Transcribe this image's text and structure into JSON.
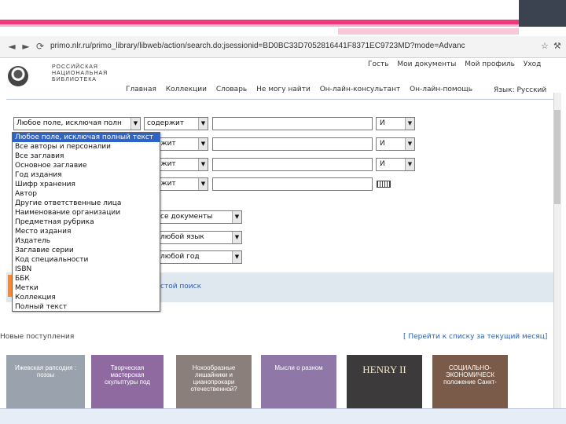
{
  "browser": {
    "url": "primo.nlr.ru/primo_library/libweb/action/search.do;jsessionid=BD0BC33D7052816441F8371EC9723MD?mode=Advanc"
  },
  "header": {
    "logo_text": "РОССИЙСКАЯ НАЦИОНАЛЬНАЯ БИБЛИОТЕКА",
    "top_links": [
      "Гость",
      "Мои документы",
      "Мой профиль",
      "Уход"
    ],
    "main_nav": [
      "Главная",
      "Коллекции",
      "Словарь",
      "Не могу найти",
      "Он-лайн-консультант",
      "Он-лайн-помощь"
    ],
    "language": "Язык: Русский"
  },
  "search": {
    "rows": [
      {
        "field": "Любое поле, исключая полн",
        "operator": "содержит",
        "bool": "И"
      },
      {
        "field": "",
        "operator": "держит",
        "bool": "И"
      },
      {
        "field": "",
        "operator": "держит",
        "bool": "И"
      },
      {
        "field": "",
        "operator": "держит",
        "bool": ""
      }
    ],
    "filters": [
      "се документы",
      "любой язык",
      "любой год"
    ],
    "advanced_link": "стой поиск"
  },
  "dropdown": {
    "items": [
      "Любое поле, исключая полный текст",
      "Все авторы и персоналии",
      "Все заглавия",
      "Основное заглавие",
      "Год издания",
      "Шифр хранения",
      "Автор",
      "Другие ответственные лица",
      "Наименование организации",
      "Предметная рубрика",
      "Место издания",
      "Издатель",
      "Заглавие серии",
      "Код специальности",
      "ISBN",
      "ББК",
      "Метки",
      "Коллекция",
      "Полный текст"
    ]
  },
  "arrivals": {
    "title": "Новые поступления",
    "link": "[ Перейти к списку за текущий месяц]",
    "books": [
      {
        "title": "Ижевская рапсодия : поэзы",
        "bg": "#9aa3ad",
        "fg": "#ffffff"
      },
      {
        "title": "Творческая мастерская скульптуры под",
        "bg": "#8e6aa0",
        "fg": "#ffffff"
      },
      {
        "title": "Нохообразные лишайники и цианопрокари отечественной?",
        "bg": "#8a7f7a",
        "fg": "#ffffff"
      },
      {
        "title": "Мысли о разном",
        "bg": "#8f78a8",
        "fg": "#ffffff"
      },
      {
        "title": "HENRY II",
        "bg": "#3c3a3a",
        "fg": "#f0e6d0"
      },
      {
        "title": "СОЦИАЛЬНО-ЭКОНОМИЧЕСК положение Санкт-",
        "bg": "#7a5a48",
        "fg": "#ffffff"
      }
    ]
  }
}
